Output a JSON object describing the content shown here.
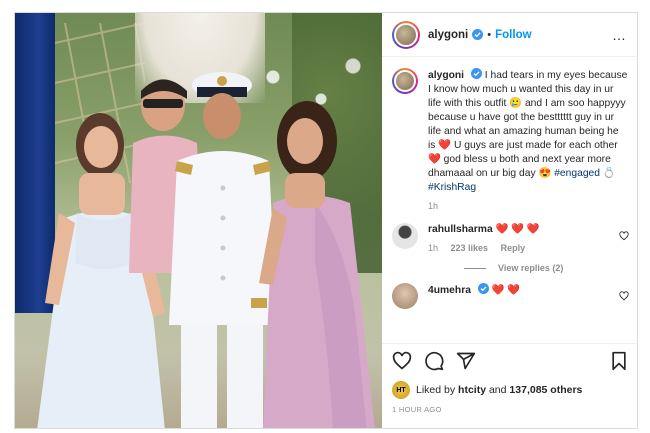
{
  "post": {
    "username": "alygoni",
    "separator": "•",
    "follow_label": "Follow",
    "more_label": "…"
  },
  "caption": {
    "username": "alygoni",
    "text": "I had tears in my eyes because I know how much u wanted this day in ur life with this outfit 🥲 and I am soo happyyy because u have got the bestttttt guy in ur life and what an amazing human being he is ❤️ U guys are just made for each other ❤️ god bless u both and next year more dhamaaal on ur big day 😍",
    "tags": "#engaged 💍 #KrishRag",
    "time": "1h"
  },
  "comments": [
    {
      "username": "rahullsharma",
      "text": "❤️ ❤️ ❤️",
      "time": "1h",
      "likes": "223 likes",
      "reply_label": "Reply",
      "view_replies": "View replies (2)"
    },
    {
      "username": "4umehra",
      "text": "❤️ ❤️"
    }
  ],
  "likes": {
    "prefix": "Liked by",
    "user": "htcity",
    "joiner": "and",
    "count": "137,085 others"
  },
  "timestamp": "1 HOUR AGO",
  "colors": {
    "accent": "#0095f6",
    "heart": "#ed4956",
    "muted": "#8e8e8e"
  },
  "icons": [
    "verified-icon",
    "heart-icon",
    "comment-icon",
    "share-icon",
    "bookmark-icon",
    "more-icon"
  ]
}
